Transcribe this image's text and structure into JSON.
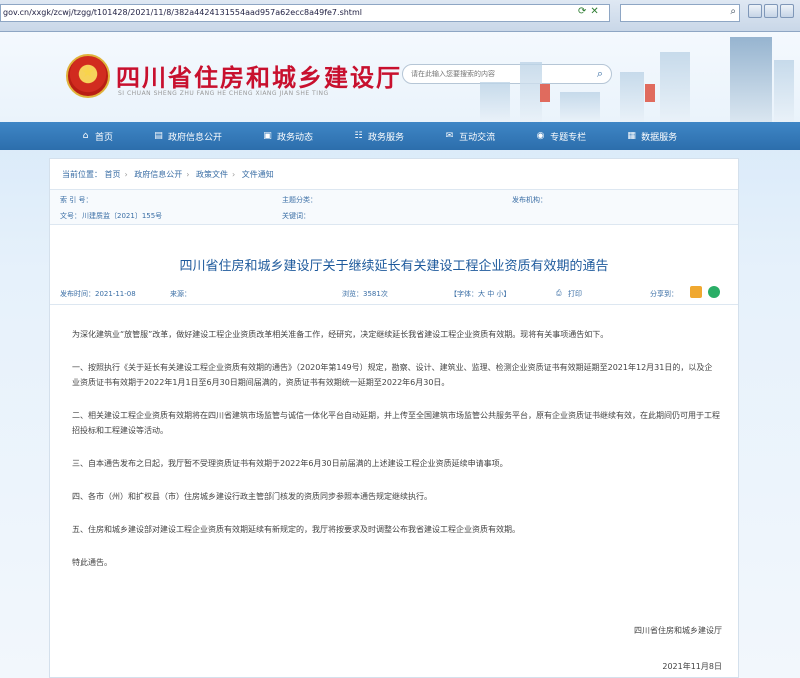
{
  "browser": {
    "url": "gov.cn/xxgk/zcwj/tzgg/t101428/2021/11/8/382a4424131554aad957a62ecc8a49fe7.shtml"
  },
  "header": {
    "title": "四川省住房和城乡建设厅",
    "subtitle": "SI CHUAN SHENG ZHU FANG HE CHENG XIANG JIAN SHE TING",
    "search_placeholder": "请在此输入您要搜索的内容"
  },
  "nav": {
    "items": [
      {
        "label": "首页",
        "icon": "home-icon"
      },
      {
        "label": "政府信息公开",
        "icon": "document-icon"
      },
      {
        "label": "政务动态",
        "icon": "news-icon"
      },
      {
        "label": "政务服务",
        "icon": "service-icon"
      },
      {
        "label": "互动交流",
        "icon": "chat-icon"
      },
      {
        "label": "专题专栏",
        "icon": "topic-icon"
      },
      {
        "label": "数据服务",
        "icon": "data-icon"
      }
    ]
  },
  "breadcrumb": {
    "prefix": "当前位置：",
    "items": [
      "首页",
      "政府信息公开",
      "政策文件",
      "文件通知"
    ]
  },
  "meta": {
    "index_label": "索 引 号：",
    "category_label": "主题分类：",
    "publisher_label": "发布机构：",
    "docno_label": "文号：",
    "docno_value": "川建质监〔2021〕155号",
    "keyword_label": "关键词："
  },
  "document": {
    "title": "四川省住房和城乡建设厅关于继续延长有关建设工程企业资质有效期的通告",
    "publish_date": "发布时间：2021-11-08",
    "source": "来源：",
    "views": "浏览：3581次",
    "font_size": "【字体：大 中 小】",
    "print": "打印",
    "share": "分享到：",
    "paragraphs": [
      "为深化建筑业“放管服”改革，做好建设工程企业资质改革相关准备工作，经研究，决定继续延长我省建设工程企业资质有效期。现将有关事项通告如下。",
      "一、按照执行《关于延长有关建设工程企业资质有效期的通告》（2020年第149号）规定，勘察、设计、建筑业、监理、检测企业资质证书有效期延期至2021年12月31日的，以及企业资质证书有效期于2022年1月1日至6月30日期间届满的，资质证书有效期统一延期至2022年6月30日。",
      "二、相关建设工程企业资质有效期将在四川省建筑市场监管与诚信一体化平台自动延期，并上传至全国建筑市场监管公共服务平台，原有企业资质证书继续有效，在此期间仍可用于工程招投标和工程建设等活动。",
      "三、自本通告发布之日起，我厅暂不受理资质证书有效期于2022年6月30日前届满的上述建设工程企业资质延续申请事项。",
      "四、各市（州）和扩权县（市）住房城乡建设行政主管部门核发的资质同步参照本通告规定继续执行。",
      "五、住房和城乡建设部对建设工程企业资质有效期延续有新规定的，我厅将按要求及时调整公布我省建设工程企业资质有效期。",
      "特此通告。"
    ],
    "signature": "四川省住房和城乡建设厅",
    "date": "2021年11月8日"
  }
}
